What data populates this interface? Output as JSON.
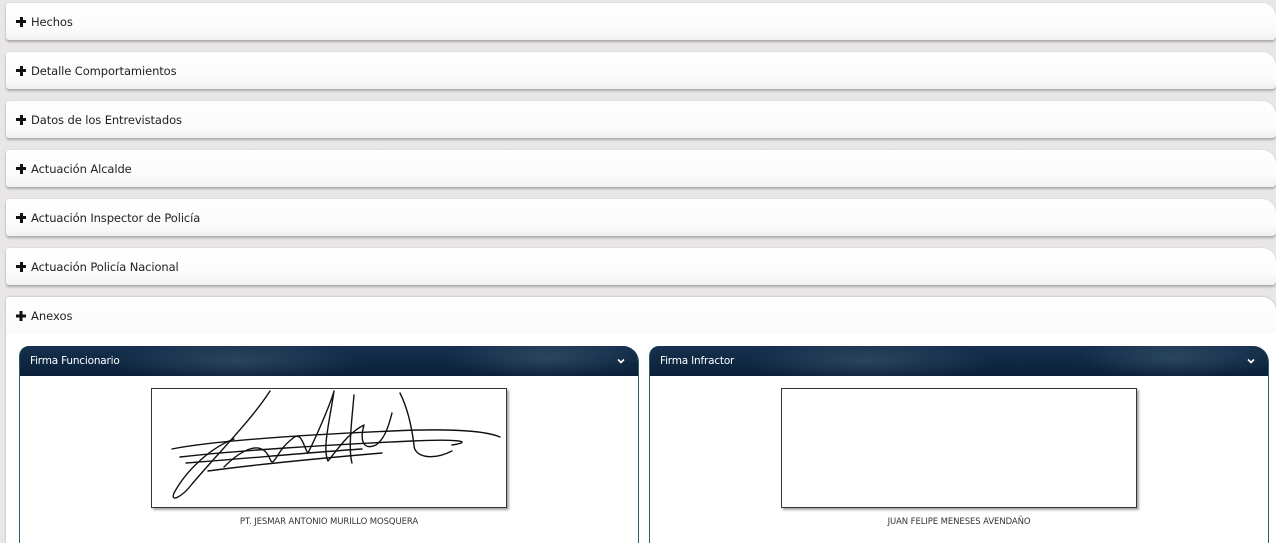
{
  "sections": [
    {
      "label": "Hechos"
    },
    {
      "label": "Detalle Comportamientos"
    },
    {
      "label": "Datos de los Entrevistados"
    },
    {
      "label": "Actuación Alcalde"
    },
    {
      "label": "Actuación Inspector de Policía"
    },
    {
      "label": "Actuación Policía Nacional"
    }
  ],
  "anexos": {
    "label": "Anexos",
    "firma_funcionario": {
      "title": "Firma Funcionario",
      "name": "PT. JESMAR ANTONIO MURILLO MOSQUERA"
    },
    "firma_infractor": {
      "title": "Firma Infractor",
      "name": "JUAN FELIPE MENESES AVENDAÑO"
    }
  },
  "icons": {
    "expand": "plus-icon",
    "collapse": "chevron-down-icon"
  },
  "colors": {
    "panel_header": "#0e2741",
    "panel_border": "#2e5d68",
    "page_background": "#e8e6e6"
  }
}
